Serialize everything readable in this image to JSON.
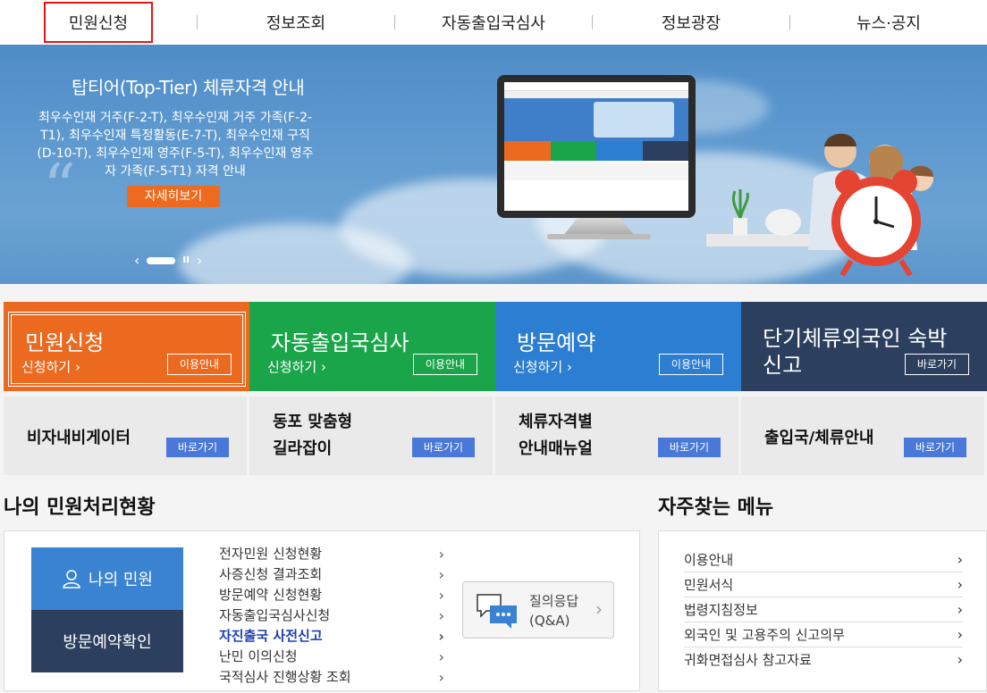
{
  "nav": {
    "items": [
      {
        "label": "민원신청",
        "active": true
      },
      {
        "label": "정보조회"
      },
      {
        "label": "자동출입국심사"
      },
      {
        "label": "정보광장"
      },
      {
        "label": "뉴스·공지"
      }
    ]
  },
  "hero": {
    "title": "탑티어(Top-Tier) 체류자격 안내",
    "text": "최우수인재 거주(F-2-T), 최우수인재 거주 가족(F-2-T1), 최우수인재 특정활동(E-7-T), 최우수인재 구직(D-10-T), 최우수인재 영주(F-5-T), 최우수인재 영주자 가족(F-5-T1) 자격 안내",
    "button": "자세히보기",
    "prev": "‹",
    "pause": "II",
    "next": "›"
  },
  "tiles": [
    {
      "title": "민원신청",
      "sub": "신청하기 ›",
      "btn": "이용안내"
    },
    {
      "title": "자동출입국심사",
      "sub": "신청하기 ›",
      "btn": "이용안내"
    },
    {
      "title": "방문예약",
      "sub": "신청하기 ›",
      "btn": "이용안내"
    },
    {
      "title1": "단기체류외국인 숙박",
      "title2": "신고",
      "btn": "바로가기"
    }
  ],
  "tiles2": [
    {
      "title1": "비자내비게이터",
      "btn": "바로가기"
    },
    {
      "title1": "동포 맞춤형",
      "title2": "길라잡이",
      "btn": "바로가기"
    },
    {
      "title1": "체류자격별",
      "title2": "안내매뉴얼",
      "btn": "바로가기"
    },
    {
      "title1": "출입국/체류안내",
      "btn": "바로가기"
    }
  ],
  "my": {
    "heading": "나의 민원처리현황",
    "btn1": "나의 민원",
    "btn2": "방문예약확인",
    "list": [
      "전자민원 신청현황",
      "사증신청 결과조회",
      "방문예약 신청현황",
      "자동출입국심사신청",
      "자진출국 사전신고",
      "난민 이의신청",
      "국적심사 진행상황 조회"
    ],
    "qna1": "질의응답",
    "qna2": "(Q&A)"
  },
  "freq": {
    "heading": "자주찾는 메뉴",
    "list": [
      "이용안내",
      "민원서식",
      "법령지침정보",
      "외국인 및 고용주의 신고의무",
      "귀화면접심사 참고자료"
    ]
  },
  "colors": {
    "orange": "#ec6a1f",
    "green": "#1ba54a",
    "blue": "#2c7ed2",
    "navy": "#2c3f5e",
    "link": "#4a78d8"
  }
}
